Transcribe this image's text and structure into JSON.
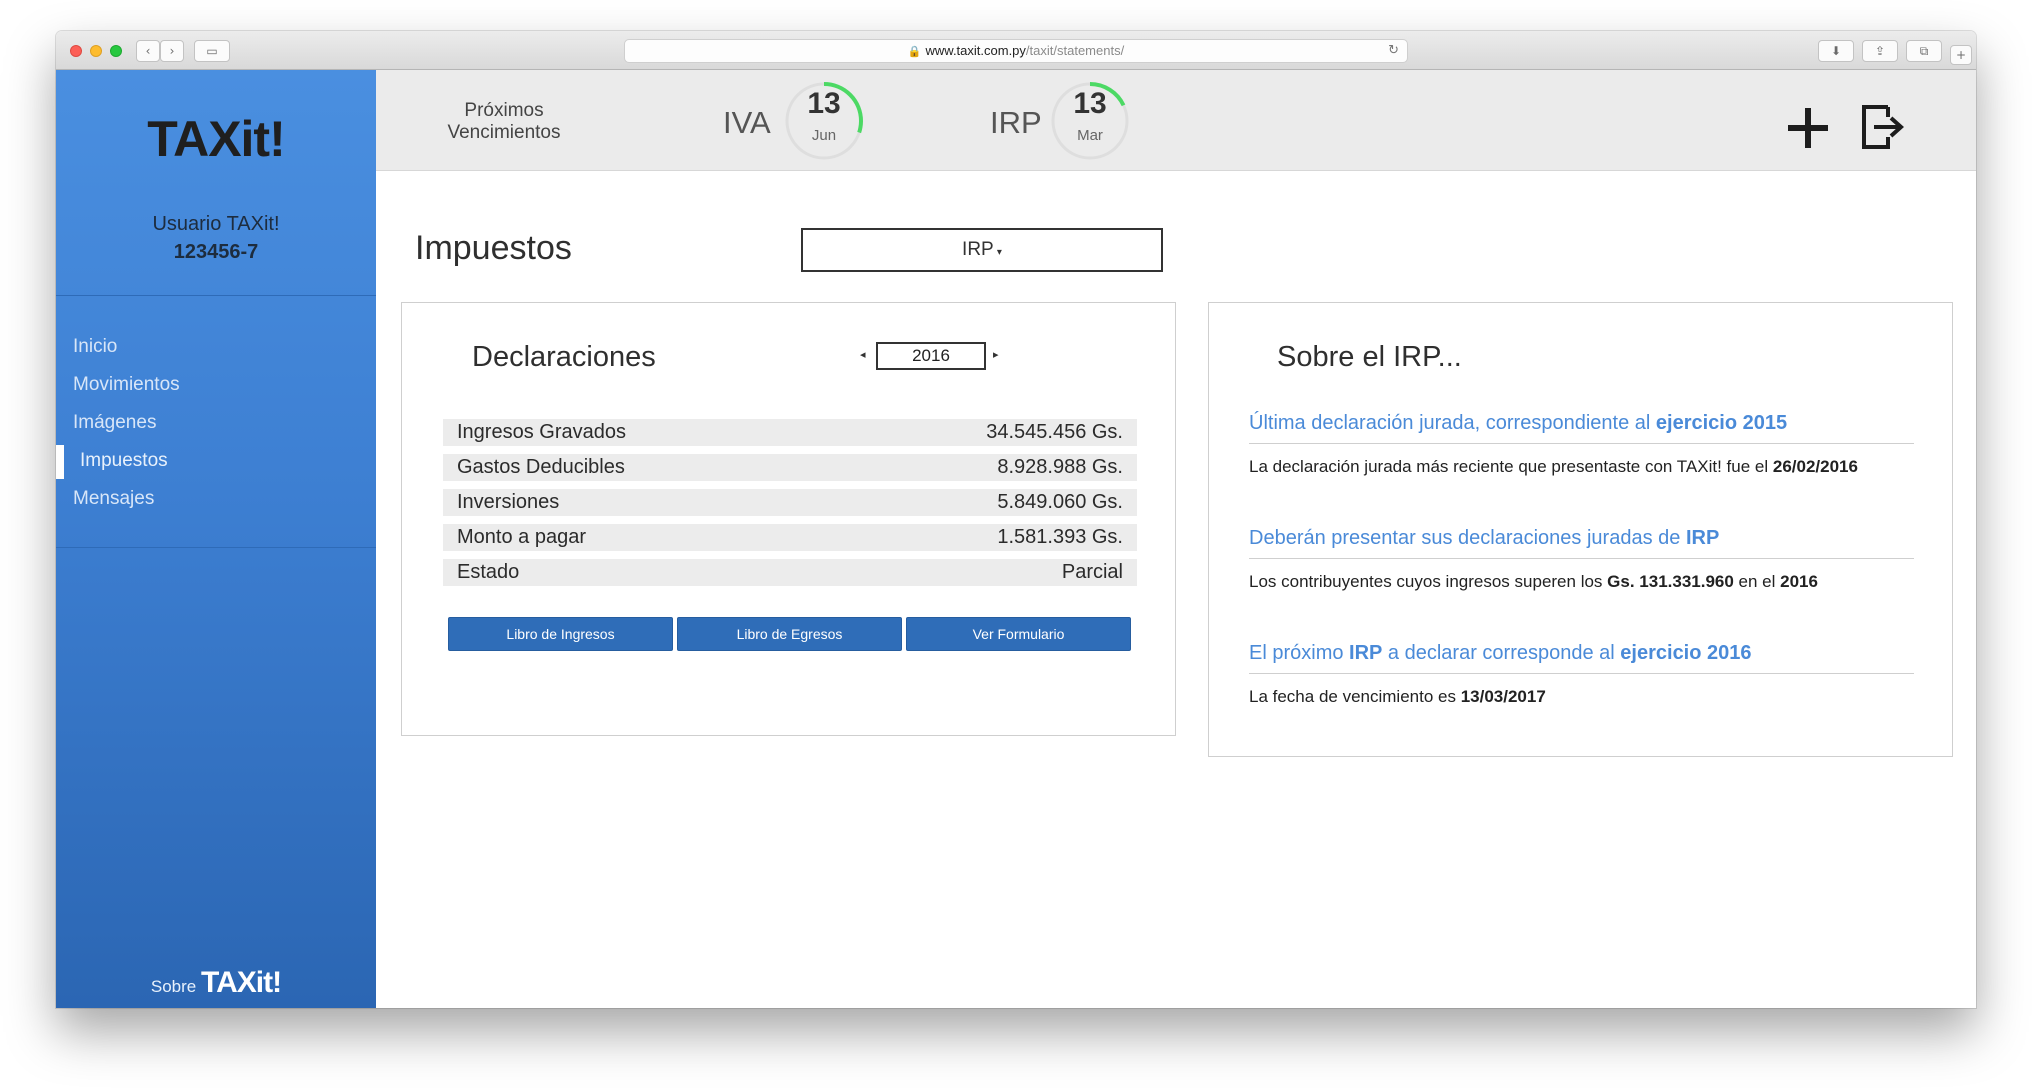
{
  "browser": {
    "url_host": "www.taxit.com.py",
    "url_path": "/taxit/statements/"
  },
  "sidebar": {
    "logo": "TAXit!",
    "user_name": "Usuario TAXit!",
    "user_id": "123456-7",
    "nav": [
      "Inicio",
      "Movimientos",
      "Imágenes",
      "Impuestos",
      "Mensajes"
    ],
    "active_index": 3,
    "about_prefix": "Sobre",
    "about_logo": "TAXit!"
  },
  "header": {
    "next_label_line1": "Próximos",
    "next_label_line2": "Vencimientos",
    "deadlines": [
      {
        "tax": "IVA",
        "day": "13",
        "month": "Jun",
        "progress": 0.3,
        "color": "#4cd964"
      },
      {
        "tax": "IRP",
        "day": "13",
        "month": "Mar",
        "progress": 0.18,
        "color": "#4cd964"
      }
    ],
    "icons": {
      "add": "plus-icon",
      "logout": "exit-icon"
    }
  },
  "main": {
    "title": "Impuestos",
    "tax_select": "IRP",
    "declarations": {
      "title": "Declaraciones",
      "year": "2016",
      "rows": [
        {
          "label": "Ingresos Gravados",
          "value": "34.545.456 Gs."
        },
        {
          "label": "Gastos Deducibles",
          "value": "8.928.988 Gs."
        },
        {
          "label": "Inversiones",
          "value": "5.849.060 Gs."
        },
        {
          "label": "Monto a pagar",
          "value": "1.581.393 Gs."
        },
        {
          "label": "Estado",
          "value": "Parcial"
        }
      ],
      "buttons": [
        "Libro de Ingresos",
        "Libro de Egresos",
        "Ver Formulario"
      ]
    },
    "about": {
      "title": "Sobre el IRP...",
      "items": [
        {
          "t1": "Última declaración jurada, correspondiente al ",
          "t1b": "ejercicio 2015",
          "d1": "La declaración jurada más reciente que presentaste con TAXit! fue el ",
          "d1b": "26/02/2016"
        },
        {
          "t1": "Deberán presentar sus declaraciones juradas de ",
          "t1b": "IRP",
          "d1": "Los contribuyentes cuyos ingresos superen los ",
          "d1b": "Gs. 131.331.960",
          "d2": " en el ",
          "d2b": "2016"
        },
        {
          "t1": "El próximo ",
          "t1b": "IRP",
          "t2": " a declarar corresponde al ",
          "t2b": "ejercicio 2016",
          "d1": "La fecha de vencimiento es ",
          "d1b": "13/03/2017"
        }
      ]
    }
  }
}
